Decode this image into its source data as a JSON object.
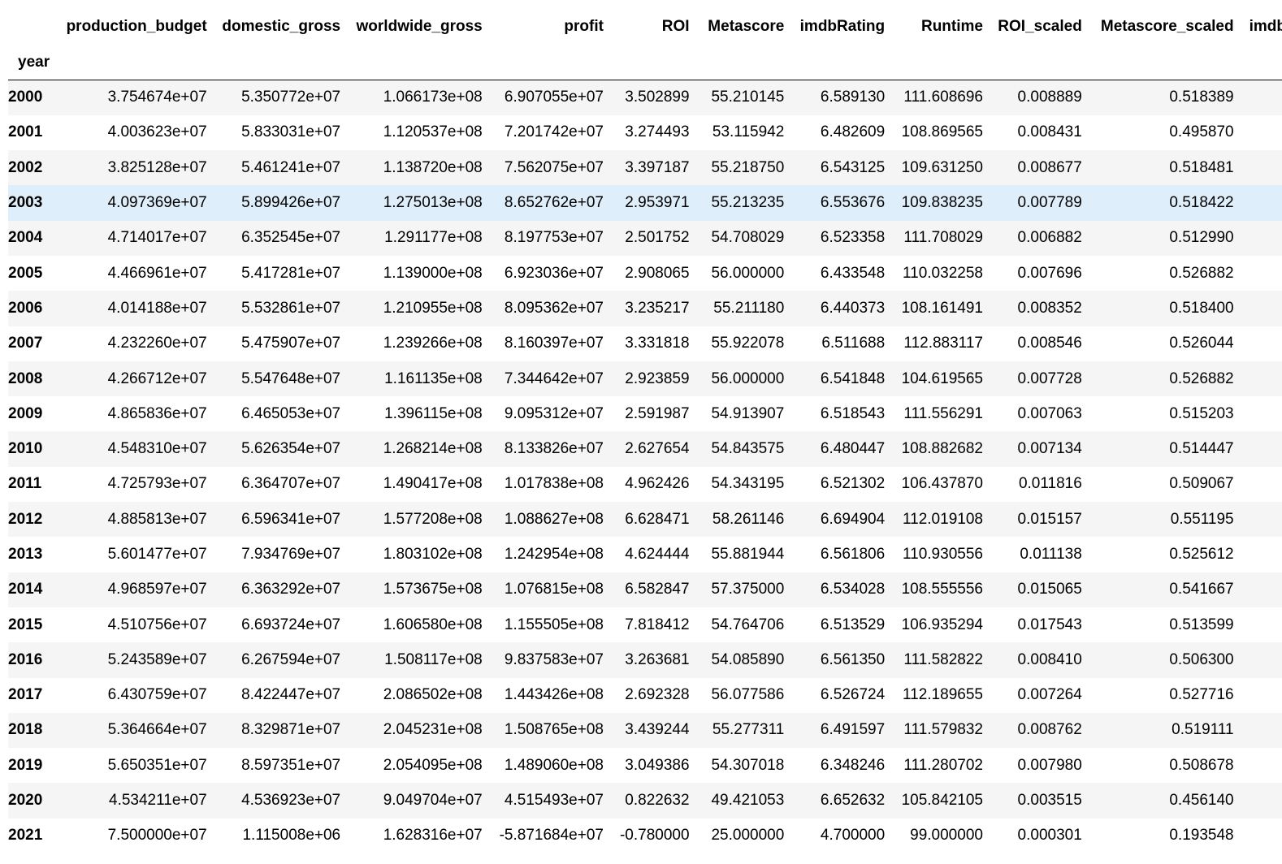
{
  "table": {
    "index_name": "year",
    "columns": [
      "production_budget",
      "domestic_gross",
      "worldwide_gross",
      "profit",
      "ROI",
      "Metascore",
      "imdbRating",
      "Runtime",
      "ROI_scaled",
      "Metascore_scaled",
      "imdbRating_scaled"
    ],
    "highlighted_row": "2003",
    "rows": [
      {
        "year": "2000",
        "cells": [
          "3.754674e+07",
          "5.350772e+07",
          "1.066173e+08",
          "6.907055e+07",
          "3.502899",
          "55.210145",
          "6.589130",
          "111.608696",
          "0.008889",
          "0.518389",
          ""
        ]
      },
      {
        "year": "2001",
        "cells": [
          "4.003623e+07",
          "5.833031e+07",
          "1.120537e+08",
          "7.201742e+07",
          "3.274493",
          "53.115942",
          "6.482609",
          "108.869565",
          "0.008431",
          "0.495870",
          ""
        ]
      },
      {
        "year": "2002",
        "cells": [
          "3.825128e+07",
          "5.461241e+07",
          "1.138720e+08",
          "7.562075e+07",
          "3.397187",
          "55.218750",
          "6.543125",
          "109.631250",
          "0.008677",
          "0.518481",
          ""
        ]
      },
      {
        "year": "2003",
        "cells": [
          "4.097369e+07",
          "5.899426e+07",
          "1.275013e+08",
          "8.652762e+07",
          "2.953971",
          "55.213235",
          "6.553676",
          "109.838235",
          "0.007789",
          "0.518422",
          ""
        ]
      },
      {
        "year": "2004",
        "cells": [
          "4.714017e+07",
          "6.352545e+07",
          "1.291177e+08",
          "8.197753e+07",
          "2.501752",
          "54.708029",
          "6.523358",
          "111.708029",
          "0.006882",
          "0.512990",
          ""
        ]
      },
      {
        "year": "2005",
        "cells": [
          "4.466961e+07",
          "5.417281e+07",
          "1.139000e+08",
          "6.923036e+07",
          "2.908065",
          "56.000000",
          "6.433548",
          "110.032258",
          "0.007696",
          "0.526882",
          ""
        ]
      },
      {
        "year": "2006",
        "cells": [
          "4.014188e+07",
          "5.532861e+07",
          "1.210955e+08",
          "8.095362e+07",
          "3.235217",
          "55.211180",
          "6.440373",
          "108.161491",
          "0.008352",
          "0.518400",
          ""
        ]
      },
      {
        "year": "2007",
        "cells": [
          "4.232260e+07",
          "5.475907e+07",
          "1.239266e+08",
          "8.160397e+07",
          "3.331818",
          "55.922078",
          "6.511688",
          "112.883117",
          "0.008546",
          "0.526044",
          ""
        ]
      },
      {
        "year": "2008",
        "cells": [
          "4.266712e+07",
          "5.547648e+07",
          "1.161135e+08",
          "7.344642e+07",
          "2.923859",
          "56.000000",
          "6.541848",
          "104.619565",
          "0.007728",
          "0.526882",
          ""
        ]
      },
      {
        "year": "2009",
        "cells": [
          "4.865836e+07",
          "6.465053e+07",
          "1.396115e+08",
          "9.095312e+07",
          "2.591987",
          "54.913907",
          "6.518543",
          "111.556291",
          "0.007063",
          "0.515203",
          ""
        ]
      },
      {
        "year": "2010",
        "cells": [
          "4.548310e+07",
          "5.626354e+07",
          "1.268214e+08",
          "8.133826e+07",
          "2.627654",
          "54.843575",
          "6.480447",
          "108.882682",
          "0.007134",
          "0.514447",
          ""
        ]
      },
      {
        "year": "2011",
        "cells": [
          "4.725793e+07",
          "6.364707e+07",
          "1.490417e+08",
          "1.017838e+08",
          "4.962426",
          "54.343195",
          "6.521302",
          "106.437870",
          "0.011816",
          "0.509067",
          ""
        ]
      },
      {
        "year": "2012",
        "cells": [
          "4.885813e+07",
          "6.596341e+07",
          "1.577208e+08",
          "1.088627e+08",
          "6.628471",
          "58.261146",
          "6.694904",
          "112.019108",
          "0.015157",
          "0.551195",
          ""
        ]
      },
      {
        "year": "2013",
        "cells": [
          "5.601477e+07",
          "7.934769e+07",
          "1.803102e+08",
          "1.242954e+08",
          "4.624444",
          "55.881944",
          "6.561806",
          "110.930556",
          "0.011138",
          "0.525612",
          ""
        ]
      },
      {
        "year": "2014",
        "cells": [
          "4.968597e+07",
          "6.363292e+07",
          "1.573675e+08",
          "1.076815e+08",
          "6.582847",
          "57.375000",
          "6.534028",
          "108.555556",
          "0.015065",
          "0.541667",
          ""
        ]
      },
      {
        "year": "2015",
        "cells": [
          "4.510756e+07",
          "6.693724e+07",
          "1.606580e+08",
          "1.155505e+08",
          "7.818412",
          "54.764706",
          "6.513529",
          "106.935294",
          "0.017543",
          "0.513599",
          ""
        ]
      },
      {
        "year": "2016",
        "cells": [
          "5.243589e+07",
          "6.267594e+07",
          "1.508117e+08",
          "9.837583e+07",
          "3.263681",
          "54.085890",
          "6.561350",
          "111.582822",
          "0.008410",
          "0.506300",
          ""
        ]
      },
      {
        "year": "2017",
        "cells": [
          "6.430759e+07",
          "8.422447e+07",
          "2.086502e+08",
          "1.443426e+08",
          "2.692328",
          "56.077586",
          "6.526724",
          "112.189655",
          "0.007264",
          "0.527716",
          ""
        ]
      },
      {
        "year": "2018",
        "cells": [
          "5.364664e+07",
          "8.329871e+07",
          "2.045231e+08",
          "1.508765e+08",
          "3.439244",
          "55.277311",
          "6.491597",
          "111.579832",
          "0.008762",
          "0.519111",
          ""
        ]
      },
      {
        "year": "2019",
        "cells": [
          "5.650351e+07",
          "8.597351e+07",
          "2.054095e+08",
          "1.489060e+08",
          "3.049386",
          "54.307018",
          "6.348246",
          "111.280702",
          "0.007980",
          "0.508678",
          ""
        ]
      },
      {
        "year": "2020",
        "cells": [
          "4.534211e+07",
          "4.536923e+07",
          "9.049704e+07",
          "4.515493e+07",
          "0.822632",
          "49.421053",
          "6.652632",
          "105.842105",
          "0.003515",
          "0.456140",
          ""
        ]
      },
      {
        "year": "2021",
        "cells": [
          "7.500000e+07",
          "1.115008e+06",
          "1.628316e+07",
          "-5.871684e+07",
          "-0.780000",
          "25.000000",
          "4.700000",
          "99.000000",
          "0.000301",
          "0.193548",
          ""
        ]
      }
    ]
  }
}
